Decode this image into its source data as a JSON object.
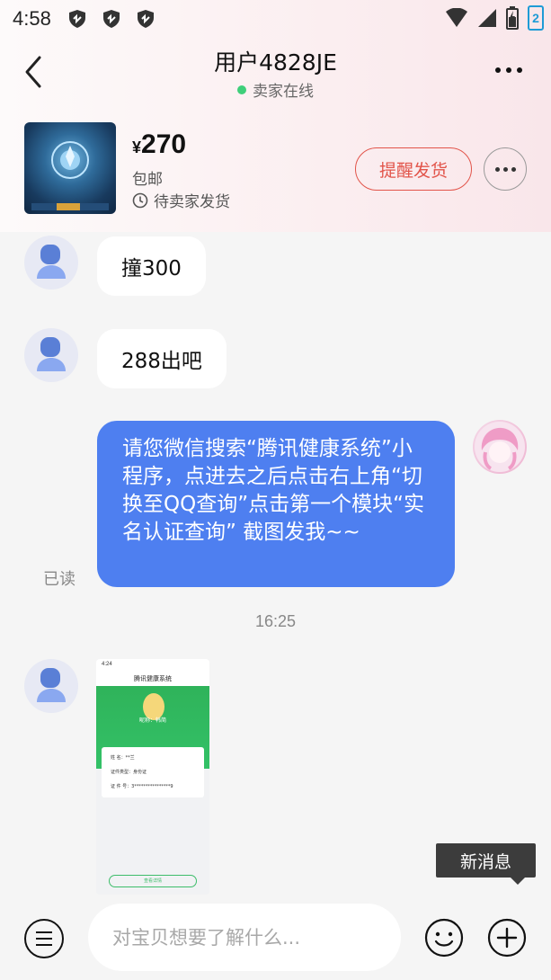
{
  "status_bar": {
    "time": "4:58",
    "sim_slot": "2"
  },
  "header": {
    "title": "用户4828JE",
    "subtitle": "卖家在线"
  },
  "product": {
    "currency": "¥",
    "price": "270",
    "shipping": "包邮",
    "status": "待卖家发货",
    "remind_label": "提醒发货"
  },
  "messages": {
    "m1": "撞300",
    "m2": "288出吧",
    "m3": "请您微信搜索“腾讯健康系统”小程序，点进去之后点击右上角“切换至QQ查询”点击第一个模块“实名认证查询” 截图发我~~",
    "read_status": "已读",
    "timestamp": "16:25"
  },
  "image_message": {
    "time": "4:24",
    "title": "腾讯健康系统",
    "name_line": "昵称：韩简",
    "row1": "姓    名：**兰",
    "row2": "证件类型：身份证",
    "row3": "证 件 号：3****************9",
    "button": "查看详情"
  },
  "toast": {
    "new_message": "新消息"
  },
  "composer": {
    "placeholder": "对宝贝想要了解什么..."
  },
  "colors": {
    "accent_red": "#e2544a",
    "bubble_blue": "#4e7ff0",
    "online_green": "#3fcf7a"
  }
}
